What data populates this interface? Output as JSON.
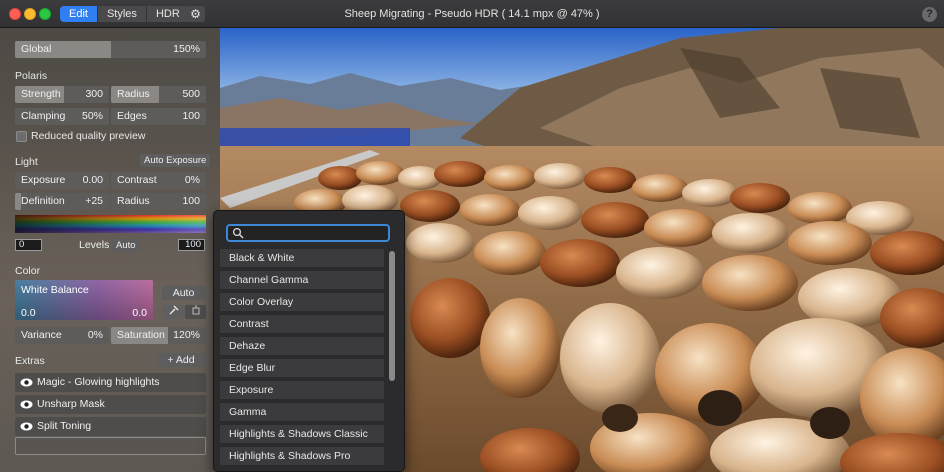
{
  "titlebar": {
    "tabs": [
      {
        "label": "Edit",
        "active": true
      },
      {
        "label": "Styles",
        "active": false
      },
      {
        "label": "HDR",
        "active": false
      }
    ],
    "title": "Sheep Migrating - Pseudo HDR ( 14.1 mpx @ 47% )",
    "help": "?"
  },
  "sidebar": {
    "global": {
      "label": "Global",
      "value": "150%",
      "fill": 0.5
    },
    "polaris": {
      "title": "Polaris",
      "strength": {
        "label": "Strength",
        "value": "300"
      },
      "radius": {
        "label": "Radius",
        "value": "500"
      },
      "clamping": {
        "label": "Clamping",
        "value": "50%"
      },
      "edges": {
        "label": "Edges",
        "value": "100"
      },
      "reduced_quality": "Reduced quality preview"
    },
    "light": {
      "title": "Light",
      "auto_exposure": "Auto Exposure",
      "exposure": {
        "label": "Exposure",
        "value": "0.00"
      },
      "contrast": {
        "label": "Contrast",
        "value": "0%"
      },
      "definition": {
        "label": "Definition",
        "value": "+25"
      },
      "radius": {
        "label": "Radius",
        "value": "100"
      },
      "levels_low": "0",
      "levels_label": "Levels",
      "levels_auto": "Auto",
      "levels_high": "100"
    },
    "color": {
      "title": "Color",
      "white_balance": "White Balance",
      "wb_left": "0.0",
      "wb_right": "0.0",
      "auto": "Auto",
      "variance": {
        "label": "Variance",
        "value": "0%"
      },
      "saturation": {
        "label": "Saturation",
        "value": "120%"
      }
    },
    "extras": {
      "title": "Extras",
      "add": "+ Add",
      "items": [
        {
          "label": "Magic - Glowing highlights"
        },
        {
          "label": "Unsharp Mask"
        },
        {
          "label": "Split Toning"
        }
      ]
    }
  },
  "popup": {
    "search_placeholder": "",
    "items": [
      "Black & White",
      "Channel Gamma",
      "Color Overlay",
      "Contrast",
      "Dehaze",
      "Edge Blur",
      "Exposure",
      "Gamma",
      "Highlights & Shadows Classic",
      "Highlights & Shadows Pro"
    ]
  },
  "colors": {
    "accent": "#2f7ff2",
    "search_focus": "#3d89d8"
  }
}
